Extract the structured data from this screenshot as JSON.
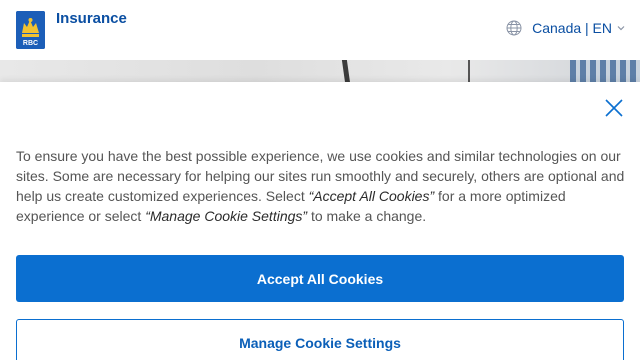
{
  "header": {
    "logo_text": "RBC",
    "brand_label": "Insurance",
    "locale_label": "Canada | EN"
  },
  "cookie_banner": {
    "message_part1": "To ensure you have the best possible experience, we use cookies and similar technologies on our sites. Some are necessary for helping our sites run smoothly and securely, others are optional and help us create customized experiences. Select ",
    "accept_quote": "“Accept All Cookies”",
    "message_part2": " for a more optimized experience or select ",
    "manage_quote": "“Manage Cookie Settings”",
    "message_part3": " to make a change.",
    "accept_label": "Accept All Cookies",
    "manage_label": "Manage Cookie Settings"
  },
  "colors": {
    "brand_blue": "#0b4fa2",
    "primary_button": "#0b6fd0",
    "logo_blue": "#1c5eb8",
    "logo_gold": "#f2c230"
  },
  "icons": [
    "rbc-logo-icon",
    "globe-icon",
    "chevron-down-icon",
    "close-icon"
  ]
}
